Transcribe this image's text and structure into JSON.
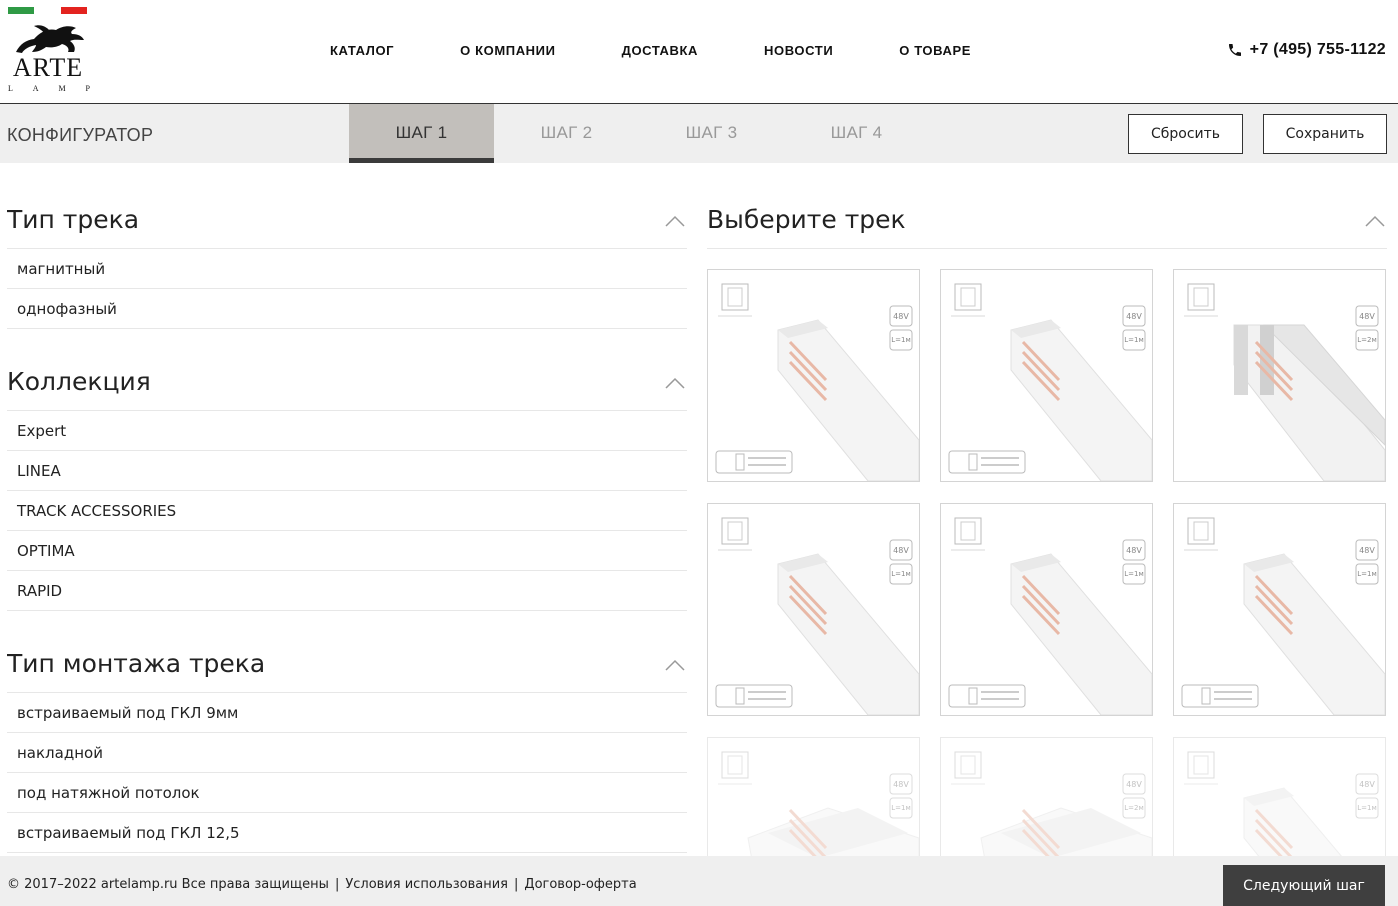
{
  "header": {
    "brand": "ARTE",
    "brand_sub": [
      "L",
      "A",
      "M",
      "P"
    ],
    "nav": [
      "КАТАЛОГ",
      "О КОМПАНИИ",
      "ДОСТАВКА",
      "НОВОСТИ",
      "О ТОВАРЕ"
    ],
    "phone": "+7 (495) 755-1122",
    "flag_colors": [
      "#2f9a45",
      "#e3231f"
    ]
  },
  "configurator": {
    "title": "КОНФИГУРАТОР",
    "tabs": [
      "ШАГ 1",
      "ШАГ 2",
      "ШАГ 3",
      "ШАГ 4"
    ],
    "active_tab": 0,
    "reset_label": "Сбросить",
    "save_label": "Сохранить"
  },
  "filters": [
    {
      "title": "Тип трека",
      "items": [
        "магнитный",
        "однофазный"
      ]
    },
    {
      "title": "Коллекция",
      "items": [
        "Expert",
        "LINEA",
        "TRACK ACCESSORIES",
        "OPTIMA",
        "RAPID"
      ]
    },
    {
      "title": "Тип монтажа трека",
      "items": [
        "встраиваемый под ГКЛ 9мм",
        "накладной",
        "под натяжной потолок",
        "встраиваемый под ГКЛ 12,5"
      ]
    }
  ],
  "tracks": {
    "title": "Выберите трек",
    "cards": [
      {
        "voltage": "48V",
        "length": "L=1м",
        "badge": true,
        "style": "recessed"
      },
      {
        "voltage": "48V",
        "length": "L=1м",
        "badge": true,
        "style": "recessed"
      },
      {
        "voltage": "48V",
        "length": "L=2м",
        "badge": false,
        "style": "double"
      },
      {
        "voltage": "48V",
        "length": "L=1м",
        "badge": true,
        "style": "block"
      },
      {
        "voltage": "48V",
        "length": "L=1м",
        "badge": true,
        "style": "block"
      },
      {
        "voltage": "48V",
        "length": "L=1м",
        "badge": true,
        "style": "block"
      },
      {
        "voltage": "48V",
        "length": "L=1м",
        "badge": false,
        "style": "flat"
      },
      {
        "voltage": "48V",
        "length": "L=2м",
        "badge": false,
        "style": "flat"
      },
      {
        "voltage": "48V",
        "length": "L=1м",
        "badge": false,
        "style": "recessed"
      }
    ]
  },
  "footer": {
    "copyright": "© 2017–2022 artelamp.ru Все права защищены",
    "terms": "Условия использования",
    "offer": "Договор-оферта",
    "separator": "|",
    "next_label": "Следующий шаг"
  }
}
